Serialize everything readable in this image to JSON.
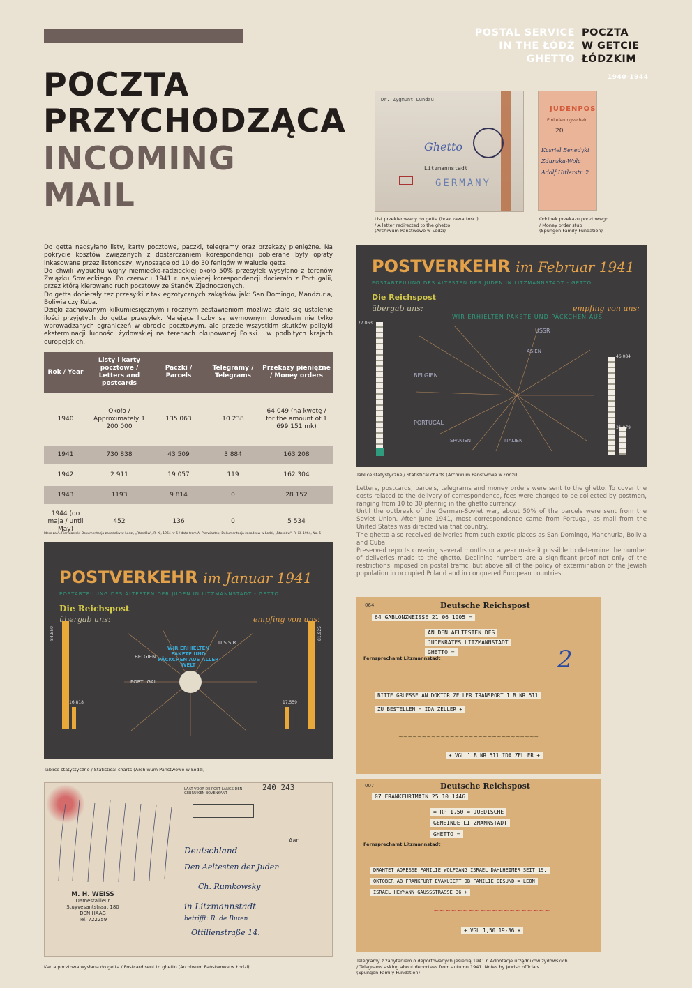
{
  "header": {
    "en_lines": [
      "POSTAL SERVICE",
      "IN THE ŁÓDŹ",
      "GHETTO"
    ],
    "pl_lines": [
      "POCZTA",
      "W GETCIE",
      "ŁÓDZKIM"
    ],
    "years": "1940-1944"
  },
  "title": {
    "pl_lines": [
      "POCZTA",
      "PRZYCHODZĄCA"
    ],
    "en_lines": [
      "INCOMING",
      "MAIL"
    ]
  },
  "intro_pl": [
    "Do getta nadsyłano listy, karty pocztowe, paczki, telegramy oraz przekazy pieniężne. Na pokrycie kosztów związanych z dostarczaniem korespondencji pobierane były opłaty inkasowane przez listonoszy, wynoszące od 10 do 30 fenigów w walucie getta.",
    "Do chwili wybuchu wojny niemiecko-radzieckiej około 50% przesyłek wysyłano z terenów Związku Sowieckiego. Po czerwcu 1941 r. najwięcej korespondencji docierało z Portugalii, przez którą kierowano ruch pocztowy ze Stanów Zjednoczonych.",
    "Do getta docierały też przesyłki z tak egzotycznych zakątków jak: San Domingo, Mandżuria, Boliwia czy Kuba.",
    "Dzięki zachowanym kilkumiesięcznym i rocznym zestawieniom możliwe stało się ustalenie ilości przyjętych do getta przesyłek. Malejące liczby są wymownym dowodem nie tylko wprowadzanych ograniczeń w obrocie pocztowym, ale przede wszystkim skutków polityki eksterminacji ludności żydowskiej na terenach okupowanej Polski i w podbitych krajach europejskich."
  ],
  "table": {
    "headers": [
      "Rok / Year",
      "Listy i karty pocztowe / Letters and postcards",
      "Paczki / Parcels",
      "Telegramy / Telegrams",
      "Przekazy pieniężne / Money orders"
    ],
    "rows": [
      [
        "1940",
        "Około / Approximately 1 200 000",
        "135 063",
        "10 238",
        "64 049 (na kwotę / for the amount of 1 699 151 mk)"
      ],
      [
        "1941",
        "730 838",
        "43 509",
        "3 884",
        "163 208"
      ],
      [
        "1942",
        "2 911",
        "19 057",
        "119",
        "162 304"
      ],
      [
        "1943",
        "1193",
        "9 814",
        "0",
        "28 152"
      ],
      [
        "1944 (do maja / until May)",
        "452",
        "136",
        "0",
        "5 534"
      ]
    ],
    "source": "Idem za A. Pierwiastek, Dokumentacja zasadców w Łodzi, „Rtosdów\", R. XI, 1964 nr 5 / data from A. Pierwiastek, Dokumentacja zasadców w Łodzi, „Rtosdów\", R. XI, 1964, No. 5"
  },
  "english_text": [
    "Letters, postcards, parcels, telegrams and money orders were sent to the ghetto. To cover the costs related to the delivery of correspondence, fees were charged to be collected by postmen, ranging from 10 to 30 pfennig in the ghetto currency.",
    "Until the outbreak of the German-Soviet war, about 50% of the parcels were sent from the Soviet Union. After June 1941, most correspondence came from Portugal, as mail from the United States was directed via that country.",
    "The ghetto also received deliveries from such exotic places as San Domingo, Manchuria, Bolivia and Cuba.",
    "Preserved reports covering several months or a year make it possible to determine the number of deliveries made to the ghetto. Declining numbers are a significant proof not only of the restrictions imposed on postal traffic, but above all of the policy of extermination of the Jewish population in occupied Poland and in conquered European countries."
  ],
  "captions": {
    "letter": [
      "List przekierowany do getta (brak zawartości)",
      "/ A letter redirected to the ghetto",
      "(Archiwum Państwowe w Łodzi)"
    ],
    "money_order": [
      "Odcinek przekazu pocztowego",
      "/ Money order stub",
      "(Spungen Family Fundation)"
    ],
    "chart_feb": "Tablice statystyczne / Statistical charts (Archiwum Państwowe w Łodzi)",
    "chart_jan": "Tablice statystyczne / Statistical charts (Archiwum Państwowe w Łodzi)",
    "postcard": "Karta pocztowa wysłana do getta / Postcard sent to ghetto (Archiwum Państwowe w Łodzi)",
    "telegrams": [
      "Telegramy z zapytaniem o deportowanych jesienią 1941 r. Adnotacje urzędników żydowskich",
      "/ Telegrams asking about deportees from autumn 1941. Notes by Jewish officials",
      "(Spungen Family Fundation)"
    ]
  },
  "chart_feb": {
    "title_a": "POSTVERKEHR",
    "title_b": "im Februar 1941",
    "subtitle": "POSTABTEILUNG DES ÄLTESTEN DER JUDEN IN LITZMANNSTADT - GETTO",
    "left_label": "Die Reichspost",
    "left_sub": "übergab uns:",
    "center": "WIR ERHIELTEN PAKETE UND PÄCKCHEN AUS",
    "right_label": "empfing von uns:",
    "left_total": "77 063",
    "right_total": "46 084",
    "right_small": "31 979",
    "countries": [
      "USSR",
      "ASIEN",
      "BELGIEN",
      "PORTUGAL",
      "SPANIEN",
      "ITALIEN"
    ]
  },
  "chart_jan": {
    "title_a": "POSTVERKEHR",
    "title_b": "im Januar 1941",
    "subtitle": "POSTABTEILUNG DES ÄLTESTEN DER JUDEN IN LITZMANNSTADT - GETTO",
    "left_label": "Die Reichspost",
    "left_sub": "übergab uns:",
    "center": "WIR ERHIELTEN PAKETE UND PÄCKCHEN AUS ALLER WELT",
    "right_label": "empfing von uns:",
    "left_total": "84.850",
    "right_total": "81.925",
    "left_small": "16.818",
    "right_small": "17.559",
    "countries": [
      "U.S.S.R.",
      "BELGIEN",
      "PORTUGAL"
    ]
  },
  "letter": {
    "line1": "Dr. Zygmunt Lundau",
    "dest": "Litzmannstadt",
    "country": "GERMANY"
  },
  "money_order": {
    "title": "JUDENPOST",
    "sub": "Einlieferungsschein",
    "amount": "20",
    "hand": [
      "Kasriel Benedykt",
      "Zdunska-Wola",
      "Adolf Hitlerstr. 2"
    ]
  },
  "postcard": {
    "number": "240 243",
    "sender_name": "M. H. WEISS",
    "sender_job": "Damestailleur",
    "sender_street": "Stuyvesantstraat 180",
    "sender_city": "DEN HAAG",
    "sender_tel": "Tel. 722259",
    "stamp": "LAAT VOOR DE POST LANGS DEN GEBRUIKEN BOVENKANT",
    "aan": "Aan",
    "hand": [
      "Deutschland",
      "Den Aeltesten der Juden",
      "Ch. Rumkowsky",
      "in Litzmannstadt",
      "betrifft: R. de Buten",
      "Ottilienstraße 14."
    ]
  },
  "telegram1": {
    "code": "064",
    "header": "Deutsche Reichspost",
    "origin": "64 GABLONZNEISSE 21 06 1005 =",
    "to1": "AN DEN AELTESTEN DES",
    "to2": "JUDENRATES LITZMANNSTADT",
    "to3": "GHETTO =",
    "msg1": "BITTE GRUESSE AN DOKTOR ZELLER TRANSPORT 1 B NR 511",
    "msg2": "ZU BESTELLEN = IDA ZELLER +",
    "foot": "+ VGL 1 B NR 511 IDA ZELLER +",
    "place": "Fernsprechamt Litzmannstadt",
    "mark": "2"
  },
  "telegram2": {
    "code": "007",
    "header": "Deutsche Reichspost",
    "origin": "07 FRANKFURTMAIN 25 10 1446",
    "to1": "= RP 1,50 = JUEDISCHE",
    "to2": "GEMEINDE LITZMANNSTADT",
    "to3": "GHETTO =",
    "msg1": "DRAHTET ADRESSE FAMILIE WOLFGANG ISRAEL DAHLHEIMER SEIT 19.",
    "msg2": "OKTOBER AB FRANKFURT EVAKUIERT OB FAMILIE GESUND = LEON",
    "msg3": "ISRAEL HEYMANN GAUSSSTRASSE 36 +",
    "foot": "+ VGL 1,50 19-36 +",
    "place": "Fernsprechamt Litzmannstadt"
  }
}
